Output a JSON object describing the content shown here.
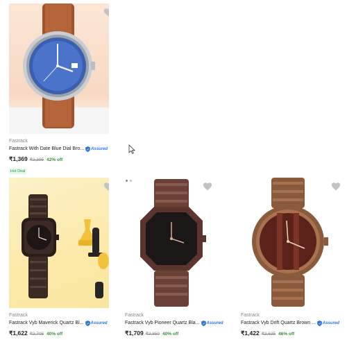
{
  "products": [
    {
      "brand": "Fastrack",
      "title": "Fastrack With Date Blue Dial Bro...",
      "assured_label": "Assured",
      "price": "₹1,369",
      "mrp": "₹2,395",
      "discount": "42% off",
      "tag": "Hot Deal"
    },
    {
      "brand": "Fastrack",
      "title": "Fastrack Vyb Maverick Quartz Bl...",
      "assured_label": "Assured",
      "price": "₹1,622",
      "mrp": "₹2,705",
      "discount": "40% off",
      "tag": ""
    },
    {
      "brand": "Fastrack",
      "title": "Fastrack Vyb Pioneer Quartz Bla...",
      "assured_label": "Assured",
      "price": "₹1,709",
      "mrp": "₹2,850",
      "discount": "40% off",
      "tag": ""
    },
    {
      "brand": "Fastrack",
      "title": "Fastrack Vyb Drift Quartz Brown ...",
      "assured_label": "Assured",
      "price": "₹1,422",
      "mrp": "₹2,635",
      "discount": "46% off",
      "tag": ""
    }
  ],
  "colors": {
    "price_off": "#388e3c",
    "assured": "#2874f0",
    "muted": "#878787",
    "wishlist": "#c2c2c2"
  },
  "icons": {
    "wishlist": "heart-icon",
    "assured": "assured-shield-icon",
    "cursor": "mouse-pointer-icon"
  }
}
